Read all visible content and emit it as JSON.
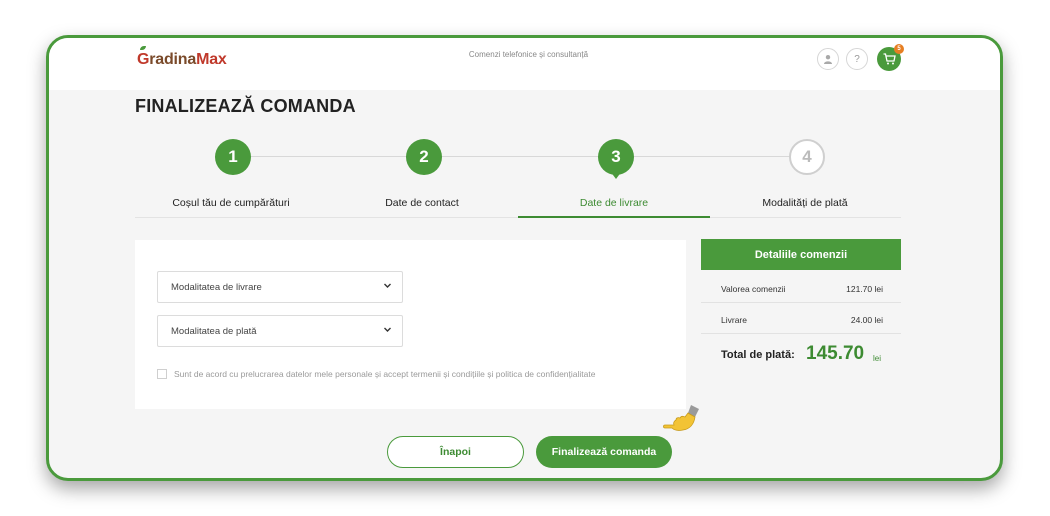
{
  "header": {
    "logo": {
      "g": "G",
      "rest_a": "radina",
      "rest_b": "Max"
    },
    "tagline": "Comenzi telefonice și consultanță",
    "icons": [
      "user-icon",
      "help-icon",
      "cart-icon"
    ],
    "help_glyph": "?",
    "cart_count": "5"
  },
  "page_title": "FINALIZEAZĂ COMANDA",
  "steps": [
    {
      "number": "1",
      "label": "Coșul tău de cumpărături",
      "state": "done"
    },
    {
      "number": "2",
      "label": "Date de contact",
      "state": "done"
    },
    {
      "number": "3",
      "label": "Date de livrare",
      "state": "active"
    },
    {
      "number": "4",
      "label": "Modalități de plată",
      "state": "inactive"
    }
  ],
  "form": {
    "delivery_select": "Modalitatea de livrare",
    "payment_select": "Modalitatea de plată",
    "consent_label": "Sunt de acord cu prelucrarea datelor mele personale și accept termenii și condițiile și politica de confidențialitate"
  },
  "summary": {
    "title": "Detaliile comenzii",
    "rows": [
      {
        "label": "Valorea comenzii",
        "value": "121.70 lei"
      },
      {
        "label": "Livrare",
        "value": "24.00 lei"
      }
    ],
    "total_label": "Total de plată:",
    "total_value": "145.70",
    "total_currency": "lei"
  },
  "buttons": {
    "back": "Înapoi",
    "finish": "Finalizează comanda"
  },
  "colors": {
    "accent": "#4a9a3c",
    "badge": "#e67e22"
  }
}
